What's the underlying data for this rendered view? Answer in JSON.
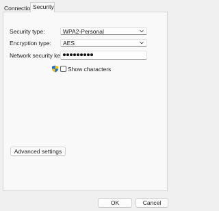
{
  "tabs": [
    {
      "label": "Connection",
      "active": false
    },
    {
      "label": "Security",
      "active": true
    }
  ],
  "security_type": {
    "label": "Security type:",
    "value": "WPA2-Personal"
  },
  "encryption_type": {
    "label": "Encryption type:",
    "value": "AES"
  },
  "network_key": {
    "label": "Network security key",
    "masked_length": 9
  },
  "show_characters": {
    "label": "Show characters",
    "checked": false
  },
  "buttons": {
    "advanced": "Advanced settings",
    "ok": "OK",
    "cancel": "Cancel"
  },
  "icons": {
    "dropdown": "chevron-down-icon",
    "uac": "uac-shield-icon"
  },
  "colors": {
    "window_bg": "#f0f0f0",
    "panel_bg": "#f9f9f9",
    "shield_blue": "#1f6fd0",
    "shield_yellow": "#f2c11a"
  }
}
